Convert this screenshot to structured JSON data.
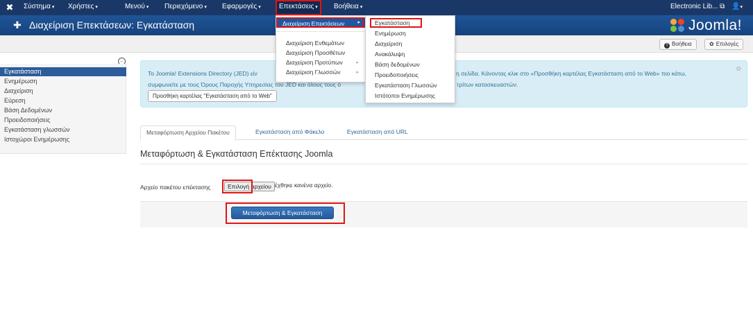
{
  "navbar": {
    "items": [
      {
        "label": "Σύστημα"
      },
      {
        "label": "Χρήστες"
      },
      {
        "label": "Μενού"
      },
      {
        "label": "Περιεχόμενο"
      },
      {
        "label": "Εφαρμογές"
      },
      {
        "label": "Επεκτάσεις"
      },
      {
        "label": "Βοήθεια"
      }
    ],
    "site_name": "Electronic Lib...",
    "external_icon": "external-link-icon",
    "user_icon": "user-icon"
  },
  "header": {
    "icon": "puzzle-icon",
    "title": "Διαχείριση Επεκτάσεων: Εγκατάσταση",
    "brand": "Joomla!"
  },
  "toolbar": {
    "help_label": "Βοήθεια",
    "options_label": "Επιλογές"
  },
  "sidebar": {
    "items": [
      {
        "label": "Εγκατάσταση"
      },
      {
        "label": "Ενημέρωση"
      },
      {
        "label": "Διαχείριση"
      },
      {
        "label": "Εύρεση"
      },
      {
        "label": "Βάση Δεδομένων"
      },
      {
        "label": "Προειδοποιήσεις"
      },
      {
        "label": "Εγκατάσταση γλωσσών"
      },
      {
        "label": "Ιστοχώροι Ενημέρωσης"
      }
    ]
  },
  "alert": {
    "line1_start": "Το Joomla! Extensions Directory (JED) είν",
    "line1_end": "η σελίδα. Κάνοντας κλικ στο «Προσθήκη καρτέλας Εγκατάσταση από το Web» πιο κάτω,",
    "line2_start": "συμφωνείτε με τους Όρους Παροχής Υπηρεσίας του JED και όλους τους ό",
    "line2_end": "ιών τρίτων κατασκευαστών.",
    "button_label": "Προσθήκη καρτέλας \"Εγκατάσταση από το Web\""
  },
  "tabs": [
    {
      "label": "Μεταφόρτωση Αρχείου Πακέτου"
    },
    {
      "label": "Εγκατάσταση από Φάκελο"
    },
    {
      "label": "Εγκατάσταση από URL"
    }
  ],
  "main": {
    "section_title": "Μεταφόρτωση & Εγκατάσταση Επέκτασης Joomla",
    "field_label": "Αρχείο πακέτου επέκτασης",
    "file_button": "Επιλογή αρχείου",
    "file_status": "Δεν επιλέχθηκε κανένα αρχείο.",
    "submit_label": "Μεταφόρτωση & Εγκατάσταση"
  },
  "menu_extensions": {
    "items": [
      {
        "label": "Διαχείριση Επεκτάσεων"
      },
      {
        "label": "Διαχείριση Ενθεμάτων"
      },
      {
        "label": "Διαχείριση Προσθέτων"
      },
      {
        "label": "Διαχείριση Προτύπων"
      },
      {
        "label": "Διαχείριση Γλωσσών"
      }
    ]
  },
  "menu_manage": {
    "items": [
      {
        "label": "Εγκατάσταση"
      },
      {
        "label": "Ενημέρωση"
      },
      {
        "label": "Διαχείριση"
      },
      {
        "label": "Ανακάλυψη"
      },
      {
        "label": "Βάση δεδομένων"
      },
      {
        "label": "Προειδοποιήσεις"
      },
      {
        "label": "Εγκατάσταση Γλωσσών"
      },
      {
        "label": "Ιστότοποι Ενημέρωσης"
      }
    ]
  },
  "colors": {
    "navbar": "#1a3867",
    "header": "#1d4f91",
    "accent": "#2f6ab0",
    "highlight": "#e01414"
  }
}
